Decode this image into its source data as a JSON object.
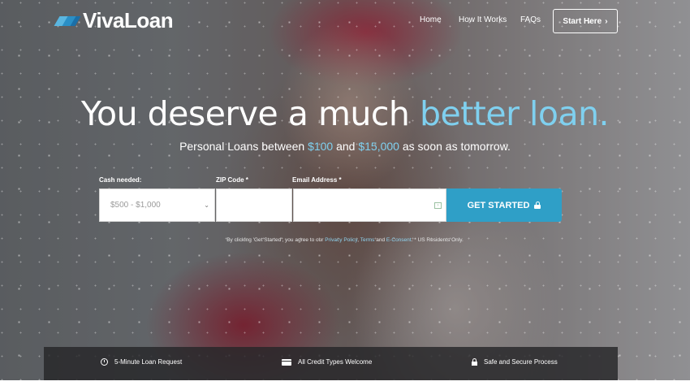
{
  "brand": {
    "name": "VivaLoan"
  },
  "nav": {
    "home": "Home",
    "how_it_works": "How It Works",
    "faqs": "FAQs",
    "start_here": "Start Here",
    "start_chevron": "›"
  },
  "hero": {
    "headline_main": "You deserve a much ",
    "headline_accent": "better loan.",
    "sub_before": "Personal Loans between ",
    "sub_min": "$100",
    "sub_mid": " and ",
    "sub_max": "$15,000",
    "sub_after": " as soon as tomorrow."
  },
  "form": {
    "cash_label": "Cash needed:",
    "cash_value": "$500 - $1,000",
    "zip_label": "ZIP Code *",
    "zip_value": "",
    "email_label": "Email Address *",
    "email_value": "",
    "submit_label": "GET STARTED",
    "caret": "⌄"
  },
  "disclaimer": {
    "before": "By clicking 'Get Started', you agree to our ",
    "privacy": "Privacy Policy",
    "comma": ", ",
    "terms": "Terms",
    "and": " and ",
    "econsent": "E-Consent",
    "after": ". * US Residents Only."
  },
  "features": [
    {
      "icon": "clock-icon",
      "label": "5-Minute Loan Request"
    },
    {
      "icon": "credit-card-icon",
      "label": "All Credit Types Welcome"
    },
    {
      "icon": "lock-icon",
      "label": "Safe and Secure Process"
    }
  ],
  "colors": {
    "accent": "#7fd0ef",
    "button": "#2f9fc7",
    "feature_bar": "#262628"
  }
}
